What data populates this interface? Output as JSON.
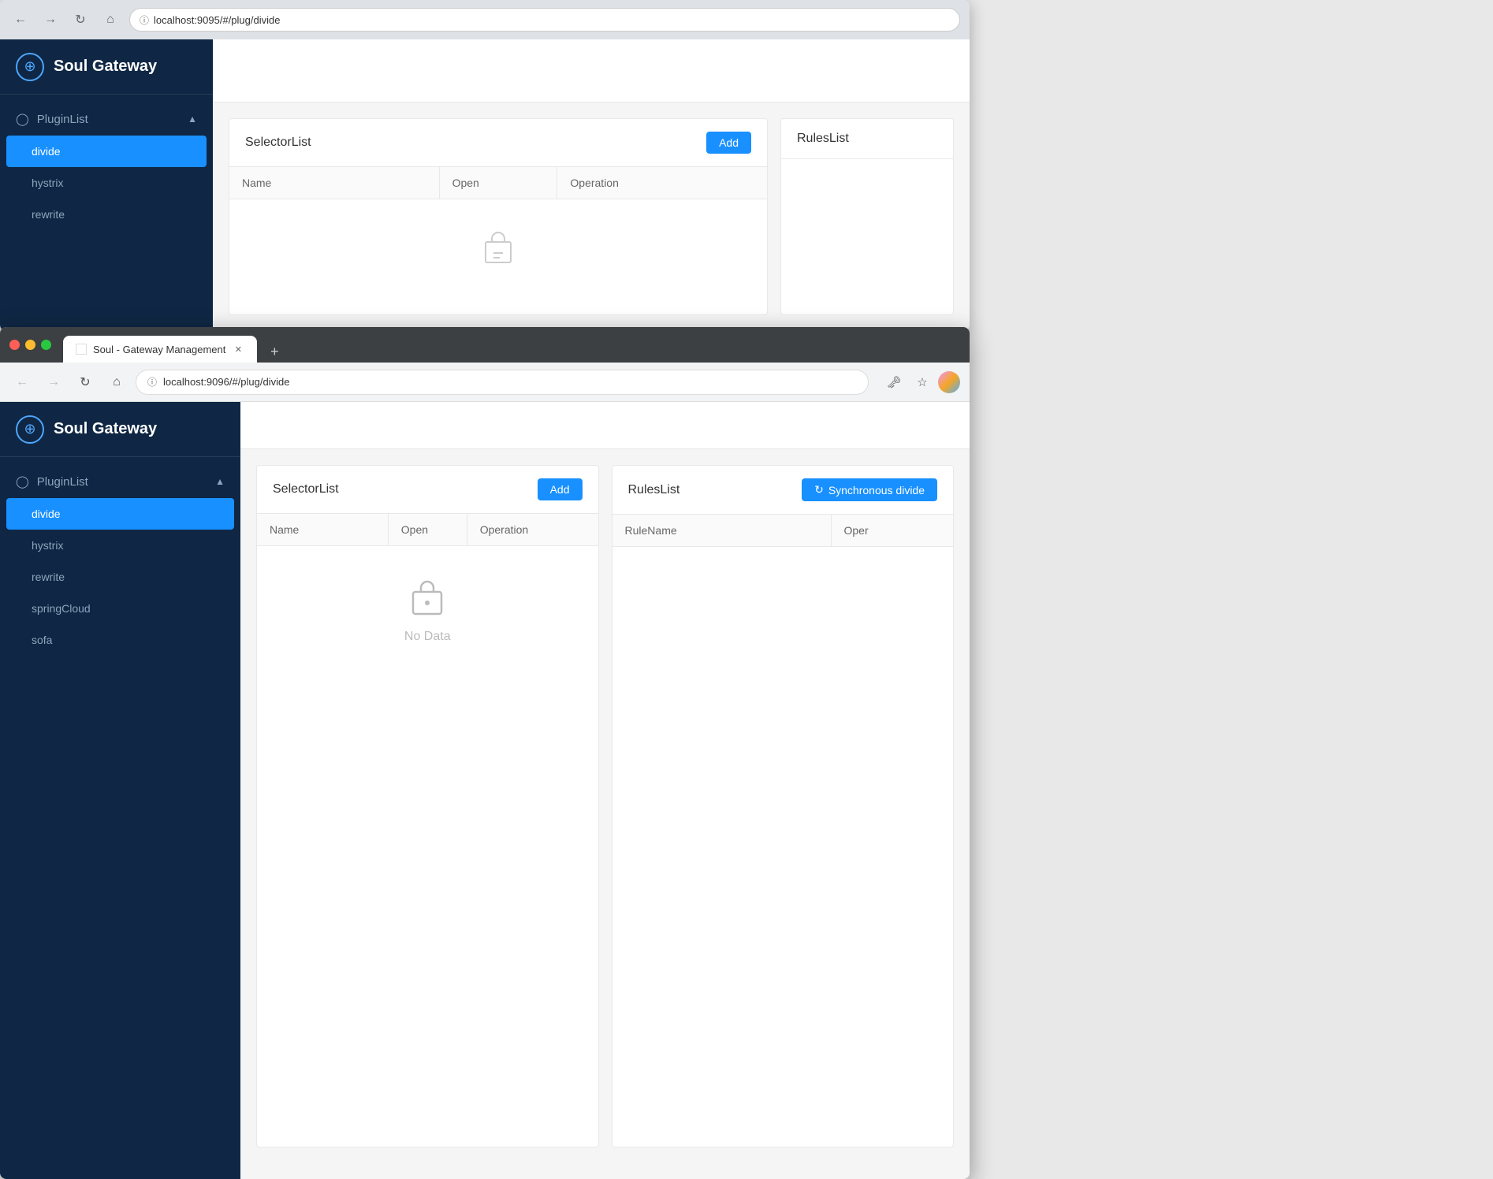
{
  "browser1": {
    "address": "localhost:9095/#/plug/divide",
    "sidebar": {
      "title": "Soul Gateway",
      "plugin_list_label": "PluginList",
      "items": [
        {
          "id": "divide",
          "label": "divide",
          "active": true
        },
        {
          "id": "hystrix",
          "label": "hystrix",
          "active": false
        },
        {
          "id": "rewrite",
          "label": "rewrite",
          "active": false
        }
      ]
    },
    "selector_panel": {
      "title": "SelectorList",
      "add_btn": "Add",
      "columns": [
        "Name",
        "Open",
        "Operation"
      ]
    },
    "rules_panel": {
      "title": "RulesList"
    }
  },
  "browser2": {
    "tab_title": "Soul - Gateway Management",
    "address": "localhost:9096/#/plug/divide",
    "sidebar": {
      "title": "Soul Gateway",
      "plugin_list_label": "PluginList",
      "items": [
        {
          "id": "divide",
          "label": "divide",
          "active": true
        },
        {
          "id": "hystrix",
          "label": "hystrix",
          "active": false
        },
        {
          "id": "rewrite",
          "label": "rewrite",
          "active": false
        },
        {
          "id": "springCloud",
          "label": "springCloud",
          "active": false
        },
        {
          "id": "sofa",
          "label": "sofa",
          "active": false
        }
      ]
    },
    "selector_panel": {
      "title": "SelectorList",
      "add_btn": "Add",
      "columns": [
        "Name",
        "Open",
        "Operation"
      ],
      "no_data": "No Data"
    },
    "rules_panel": {
      "title": "RulesList",
      "sync_btn": "Synchronous divide",
      "columns": [
        "RuleName",
        "Oper"
      ]
    }
  }
}
